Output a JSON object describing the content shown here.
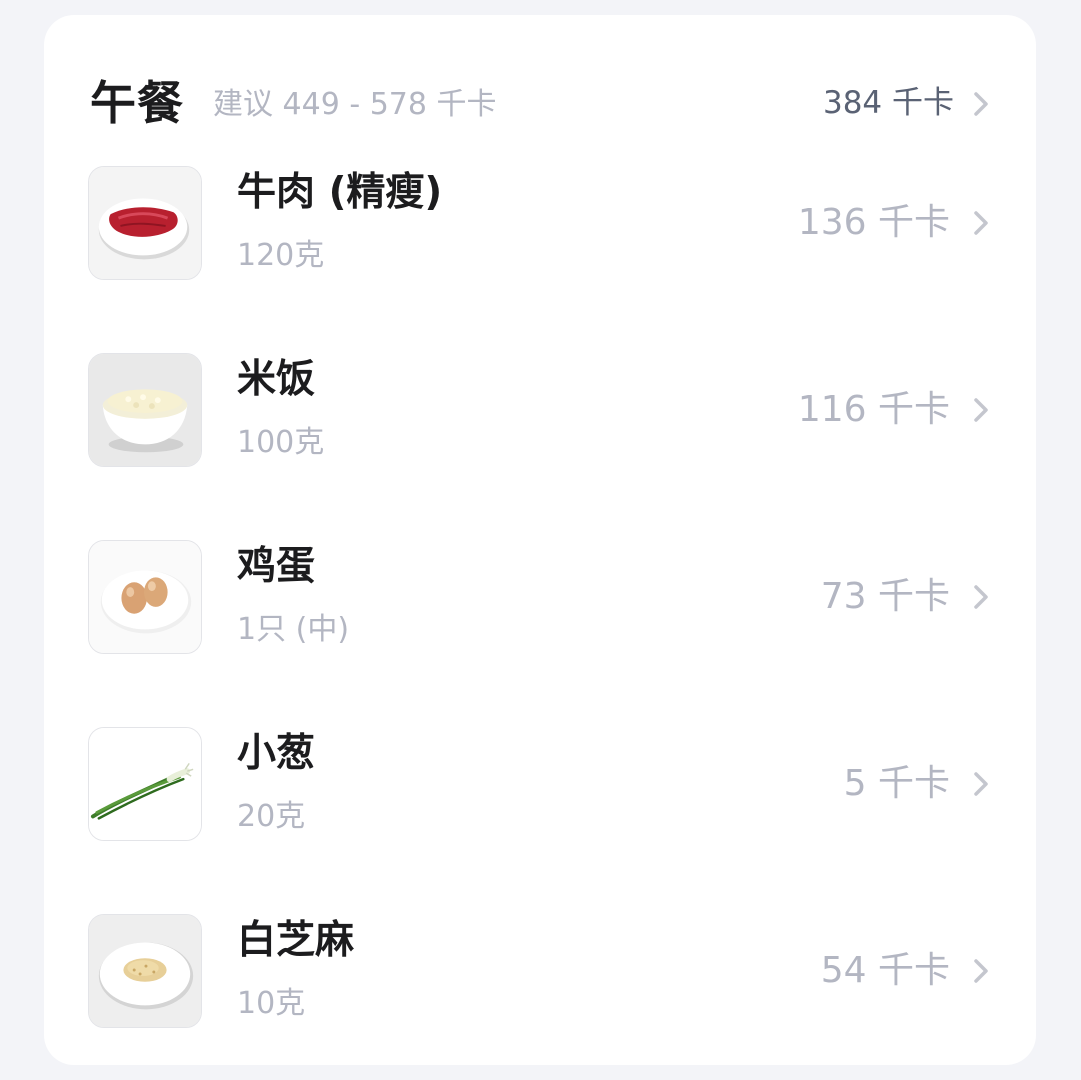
{
  "meal": {
    "title": "午餐",
    "suggestion": "建议 449 - 578 千卡",
    "total": "384 千卡"
  },
  "foods": [
    {
      "name": "牛肉 (精瘦)",
      "amount": "120克",
      "kcal": "136 千卡",
      "image": "beef-photo"
    },
    {
      "name": "米饭",
      "amount": "100克",
      "kcal": "116 千卡",
      "image": "rice-photo"
    },
    {
      "name": "鸡蛋",
      "amount": "1只 (中)",
      "kcal": "73 千卡",
      "image": "eggs-photo"
    },
    {
      "name": "小葱",
      "amount": "20克",
      "kcal": "5 千卡",
      "image": "scallion-photo"
    },
    {
      "name": "白芝麻",
      "amount": "10克",
      "kcal": "54 千卡",
      "image": "sesame-photo"
    }
  ],
  "colors": {
    "background": "#f3f4f8",
    "card": "#ffffff",
    "title": "#1c1c1e",
    "muted": "#b3b6c2",
    "total": "#5a6274",
    "chevron": "#c4c6ce"
  },
  "icons": {
    "chevron": "chevron-right-icon"
  }
}
